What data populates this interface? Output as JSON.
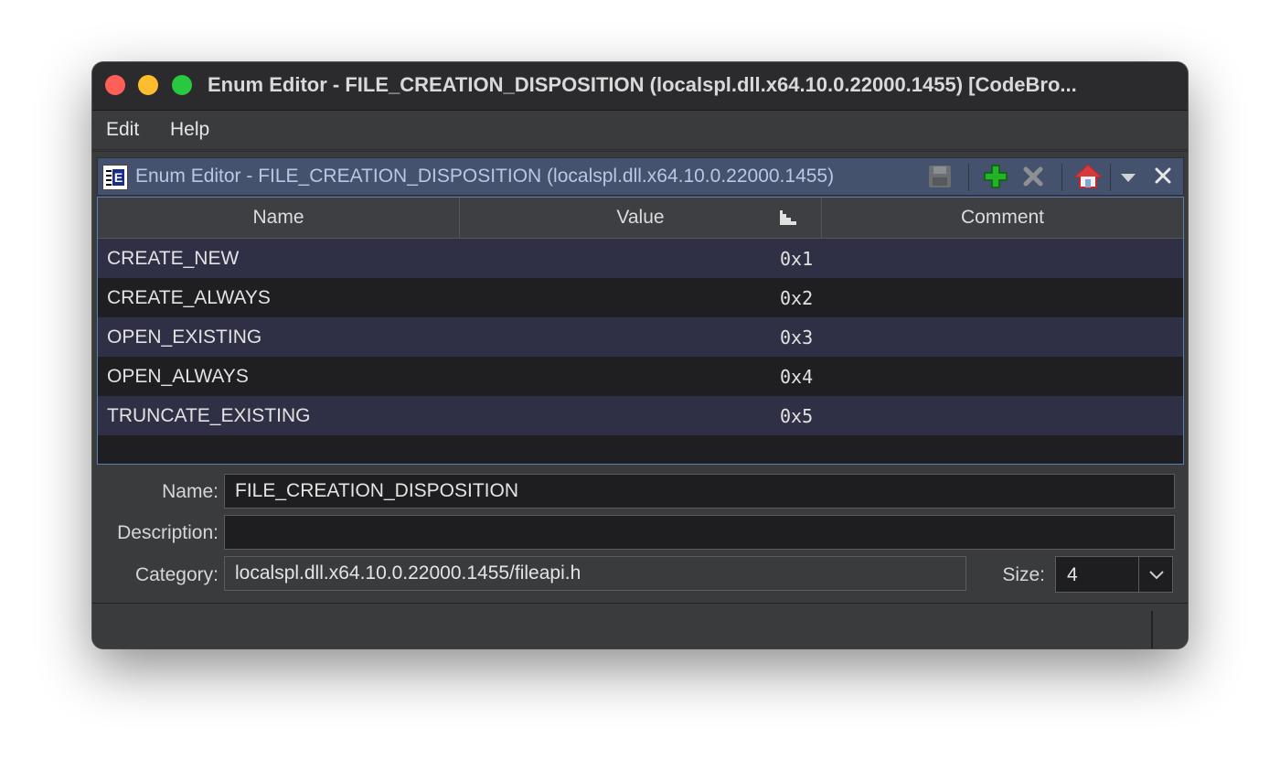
{
  "window": {
    "title": "Enum Editor - FILE_CREATION_DISPOSITION (localspl.dll.x64.10.0.22000.1455) [CodeBro..."
  },
  "menubar": {
    "items": [
      {
        "label": "Edit"
      },
      {
        "label": "Help"
      }
    ]
  },
  "panel": {
    "title": "Enum Editor - FILE_CREATION_DISPOSITION (localspl.dll.x64.10.0.22000.1455)",
    "icon_letter": "E",
    "toolbar": [
      "save-icon",
      "add-icon",
      "delete-icon",
      "home-icon",
      "menu-dropdown-icon",
      "close-icon"
    ]
  },
  "table": {
    "columns": [
      "Name",
      "Value",
      "Comment"
    ],
    "rows": [
      {
        "name": "CREATE_NEW",
        "value": "0x1",
        "comment": ""
      },
      {
        "name": "CREATE_ALWAYS",
        "value": "0x2",
        "comment": ""
      },
      {
        "name": "OPEN_EXISTING",
        "value": "0x3",
        "comment": ""
      },
      {
        "name": "OPEN_ALWAYS",
        "value": "0x4",
        "comment": ""
      },
      {
        "name": "TRUNCATE_EXISTING",
        "value": "0x5",
        "comment": ""
      }
    ]
  },
  "form": {
    "name_label": "Name:",
    "name_value": "FILE_CREATION_DISPOSITION",
    "description_label": "Description:",
    "description_value": "",
    "category_label": "Category:",
    "category_value": "localspl.dll.x64.10.0.22000.1455/fileapi.h",
    "size_label": "Size:",
    "size_value": "4"
  },
  "colors": {
    "header_bg": "#45526e",
    "row_alt": "#2f3045",
    "add_green": "#22b327",
    "close_red": "#fe5f57"
  }
}
